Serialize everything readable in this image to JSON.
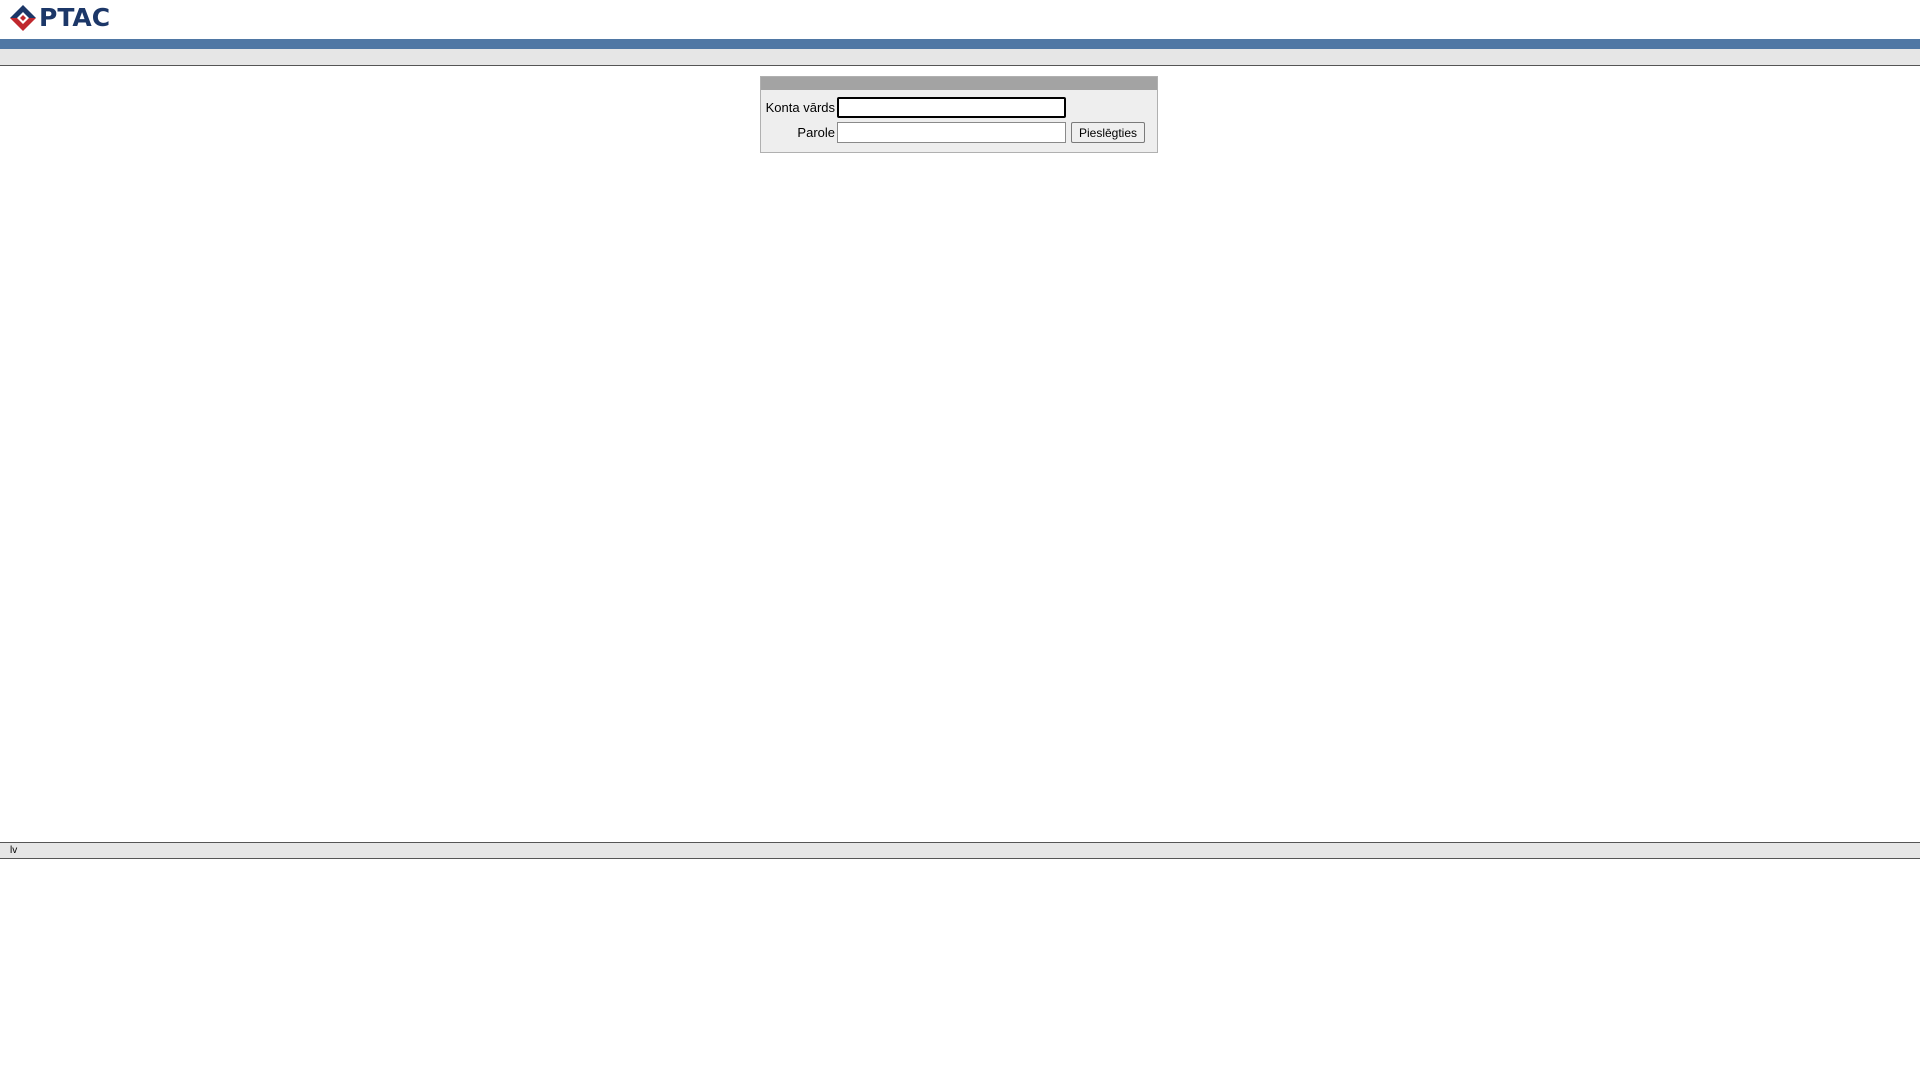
{
  "brand": {
    "name": "PTAC",
    "text_color": "#1c3768",
    "mark_colors": {
      "red": "#c0282d",
      "navy": "#1c3768"
    }
  },
  "colors": {
    "blue_bar": "#4f77a4",
    "gray_bar": "#e6e6e6",
    "login_title_bar": "#a3a3a3",
    "login_body": "#eeeeee"
  },
  "login": {
    "username_label": "Konta vārds",
    "username_value": "",
    "password_label": "Parole",
    "password_value": "",
    "submit_label": "Pieslēgties"
  },
  "footer": {
    "language": "lv"
  }
}
